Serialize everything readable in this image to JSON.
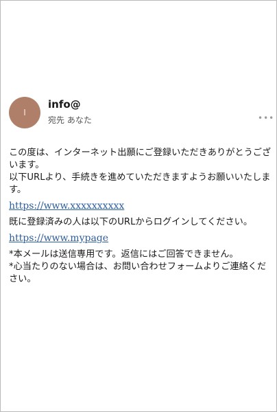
{
  "email": {
    "avatar_initial": "I",
    "sender": "info@",
    "recipient_line": "宛先 あなた",
    "more_icon": "•••"
  },
  "message": {
    "line1": "この度は、インターネット出願にご登録いただきありがとうございます。",
    "line2": "以下URLより、手続きを進めていただきますようお願いいたします。",
    "link1": "https://www.xxxxxxxxxx",
    "line3": "既に登録済みの人は以下のURLからログインしてください。",
    "link2": "https://www.mypage",
    "note1": "*本メールは送信専用です。返信にはご回答できません。",
    "note2": "*心当たりのない場合は、お問い合わせフォームよりご連絡ください。"
  },
  "colors": {
    "avatar_bg": "#b07f6a",
    "link": "#2d5d9b"
  }
}
